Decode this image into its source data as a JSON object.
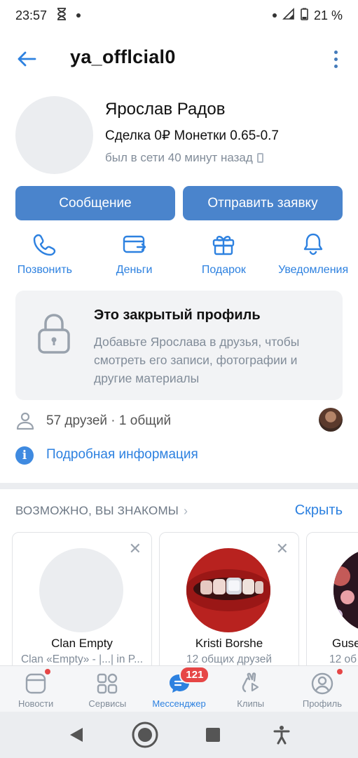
{
  "status_bar": {
    "time": "23:57",
    "battery": "21 %"
  },
  "header": {
    "screen_name": "ya_offlcial0"
  },
  "profile": {
    "name": "Ярослав Радов",
    "status": "Сделка 0₽ Монетки 0.65-0.7",
    "last_seen": "был в сети 40 минут назад"
  },
  "buttons": {
    "message": "Сообщение",
    "add_friend": "Отправить заявку"
  },
  "actions": [
    {
      "label": "Позвонить",
      "icon": "phone-icon"
    },
    {
      "label": "Деньги",
      "icon": "money-card-icon"
    },
    {
      "label": "Подарок",
      "icon": "gift-icon"
    },
    {
      "label": "Уведомления",
      "icon": "bell-icon"
    }
  ],
  "closed_profile": {
    "title": "Это закрытый профиль",
    "description": "Добавьте Ярослава в друзья, чтобы смотреть его записи, фотографии и другие материалы"
  },
  "friends": {
    "text": "57 друзей · 1 общий"
  },
  "info_link": "Подробная информация",
  "suggestions": {
    "title": "ВОЗМОЖНО, ВЫ ЗНАКОМЫ",
    "hide": "Скрыть",
    "cards": [
      {
        "name": "Clan Empty",
        "subtitle": "Clan «Empty» - |...| in P..."
      },
      {
        "name": "Kristi Borshe",
        "subtitle": "12 общих друзей"
      },
      {
        "name": "Guse",
        "subtitle": "12 об"
      }
    ]
  },
  "tabs": [
    {
      "label": "Новости",
      "icon": "news-icon"
    },
    {
      "label": "Сервисы",
      "icon": "services-icon"
    },
    {
      "label": "Мессенджер",
      "icon": "messenger-icon",
      "badge": "121"
    },
    {
      "label": "Клипы",
      "icon": "clips-icon"
    },
    {
      "label": "Профиль",
      "icon": "profile-icon"
    }
  ],
  "colors": {
    "accent": "#2d81e0",
    "button": "#4a84cc",
    "badge": "#e64646"
  }
}
